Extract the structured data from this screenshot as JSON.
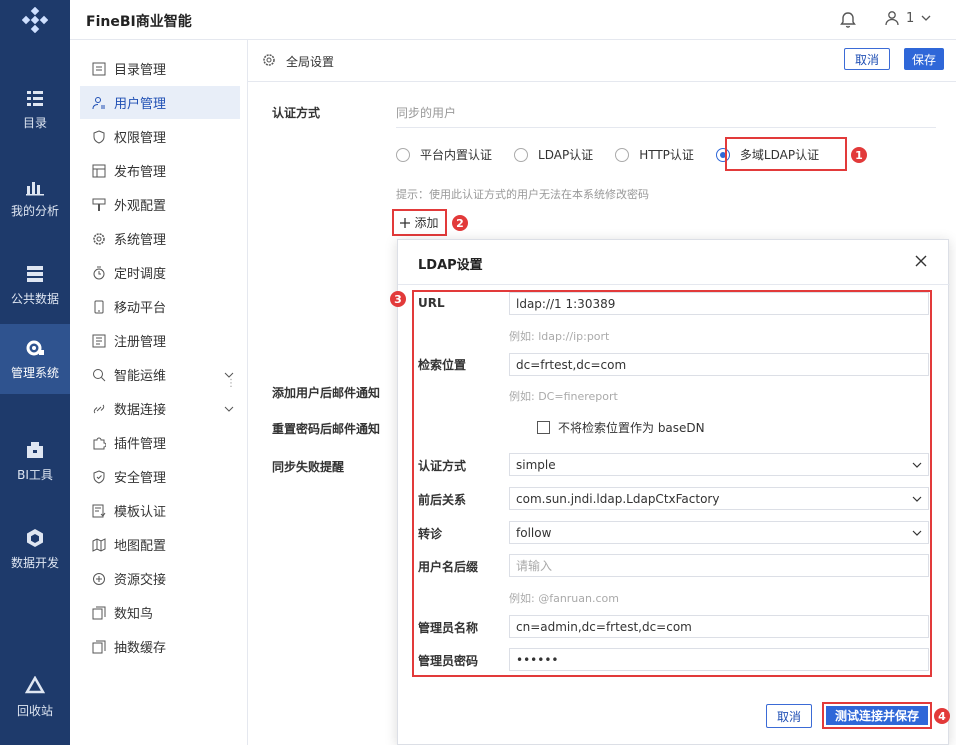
{
  "app": {
    "title": "FineBI商业智能",
    "user": "1"
  },
  "rail": [
    {
      "label": "目录",
      "icon": "catalog-icon"
    },
    {
      "label": "我的分析",
      "icon": "analysis-icon"
    },
    {
      "label": "公共数据",
      "icon": "data-icon"
    },
    {
      "label": "管理系统",
      "icon": "manage-icon",
      "active": true
    },
    {
      "label": "BI工具",
      "icon": "toolbox-icon"
    },
    {
      "label": "数据开发",
      "icon": "cube-icon"
    },
    {
      "label": "回收站",
      "icon": "recycle-icon"
    }
  ],
  "sidebar": {
    "items": [
      {
        "label": "目录管理"
      },
      {
        "label": "用户管理",
        "active": true
      },
      {
        "label": "权限管理"
      },
      {
        "label": "发布管理"
      },
      {
        "label": "外观配置"
      },
      {
        "label": "系统管理"
      },
      {
        "label": "定时调度"
      },
      {
        "label": "移动平台"
      },
      {
        "label": "注册管理"
      },
      {
        "label": "智能运维",
        "expandable": true
      },
      {
        "label": "数据连接",
        "expandable": true
      },
      {
        "label": "插件管理"
      },
      {
        "label": "安全管理"
      },
      {
        "label": "模板认证"
      },
      {
        "label": "地图配置"
      },
      {
        "label": "资源交接"
      },
      {
        "label": "数知鸟"
      },
      {
        "label": "抽数缓存"
      }
    ]
  },
  "header": {
    "title": "全局设置",
    "cancel": "取消",
    "save": "保存"
  },
  "auth": {
    "label": "认证方式",
    "sync_user": "同步的用户",
    "options": [
      "平台内置认证",
      "LDAP认证",
      "HTTP认证",
      "多域LDAP认证"
    ],
    "selected": "多域LDAP认证",
    "hint": "提示：使用此认证方式的用户无法在本系统修改密码",
    "add": "添加"
  },
  "behind_labels": {
    "add_user_mail": "添加用户后邮件通知",
    "reset_pwd_mail": "重置密码后邮件通知",
    "sync_fail": "同步失败提醒"
  },
  "badges": [
    "1",
    "2",
    "3",
    "4"
  ],
  "dialog": {
    "title": "LDAP设置",
    "url_label": "URL",
    "url_value": "ldap://1            1:30389",
    "url_eg": "例如: ldap://ip:port",
    "search_label": "检索位置",
    "search_value": "dc=frtest,dc=com",
    "search_eg": "例如: DC=finereport",
    "checkbox_label": "不将检索位置作为 baseDN",
    "auth_label": "认证方式",
    "auth_value": "simple",
    "context_label": "前后关系",
    "context_value": "com.sun.jndi.ldap.LdapCtxFactory",
    "referral_label": "转诊",
    "referral_value": "follow",
    "suffix_label": "用户名后缀",
    "suffix_placeholder": "请输入",
    "suffix_eg": "例如: @fanruan.com",
    "admin_label": "管理员名称",
    "admin_value": "cn=admin,dc=frtest,dc=com",
    "pwd_label": "管理员密码",
    "pwd_value": "••••••",
    "cancel": "取消",
    "ok": "测试连接并保存"
  }
}
